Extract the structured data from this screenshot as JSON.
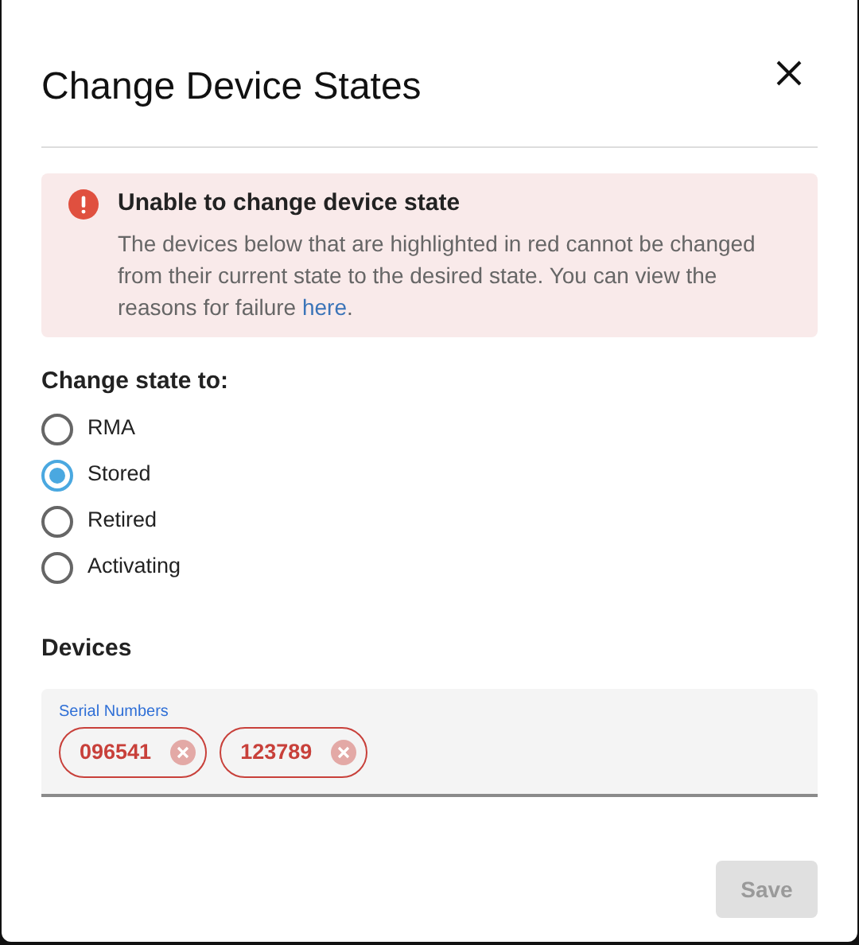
{
  "dialog": {
    "title": "Change Device States"
  },
  "alert": {
    "error": true,
    "title": "Unable to change device state",
    "message_before": "The devices below that are highlighted in red cannot be changed from their current state to the desired state. You can view the reasons for failure ",
    "link": "here",
    "message_after": "."
  },
  "state_group": {
    "label": "Change state to:",
    "options": [
      {
        "label": "RMA",
        "selected": false
      },
      {
        "label": "Stored",
        "selected": true
      },
      {
        "label": "Retired",
        "selected": false
      },
      {
        "label": "Activating",
        "selected": false
      }
    ]
  },
  "devices": {
    "heading": "Devices",
    "field_label": "Serial Numbers",
    "chips": [
      {
        "label": "096541",
        "error": true
      },
      {
        "label": "123789",
        "error": true
      }
    ]
  },
  "save_button": {
    "label": "Save",
    "disabled": true
  }
}
